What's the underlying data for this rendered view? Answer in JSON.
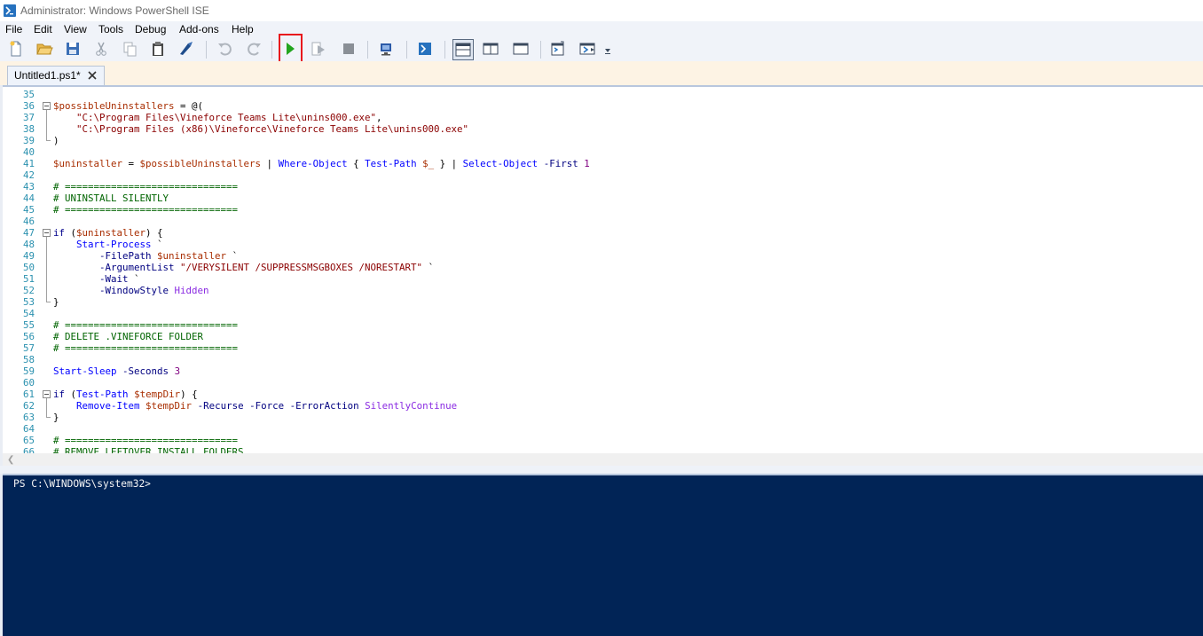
{
  "window": {
    "title": "Administrator: Windows PowerShell ISE",
    "icon": "powershell-ise-icon"
  },
  "menu": [
    "File",
    "Edit",
    "View",
    "Tools",
    "Debug",
    "Add-ons",
    "Help"
  ],
  "toolbar": {
    "buttons": [
      "new-script-icon",
      "open-icon",
      "save-icon",
      "cut-icon",
      "copy-icon",
      "paste-icon",
      "clear-console-icon",
      "undo-icon",
      "redo-icon",
      "run-script-icon",
      "run-selection-icon",
      "stop-icon",
      "new-remote-tab-icon",
      "start-powershell-icon",
      "show-script-pane-top-icon",
      "show-script-pane-right-icon",
      "show-script-pane-maximized-icon",
      "show-command-window-icon",
      "show-command-addon-icon",
      "customize-toolbar-icon"
    ],
    "highlighted": "run-script-icon",
    "highlight_color": "#e8161c",
    "run_color": "#22a51f"
  },
  "tab": {
    "label": "Untitled1.ps1*",
    "close": "×"
  },
  "editor": {
    "lines": [
      {
        "n": "35",
        "segments": []
      },
      {
        "n": "36",
        "segments": [
          {
            "t": "var",
            "v": "$possibleUninstallers"
          },
          {
            "t": "plain",
            "v": " = @("
          }
        ]
      },
      {
        "n": "37",
        "segments": [
          {
            "t": "plain",
            "v": "    "
          },
          {
            "t": "str",
            "v": "\"C:\\Program Files\\Vineforce Teams Lite\\unins000.exe\""
          },
          {
            "t": "plain",
            "v": ","
          }
        ]
      },
      {
        "n": "38",
        "segments": [
          {
            "t": "plain",
            "v": "    "
          },
          {
            "t": "str",
            "v": "\"C:\\Program Files (x86)\\Vineforce\\Vineforce Teams Lite\\unins000.exe\""
          }
        ]
      },
      {
        "n": "39",
        "segments": [
          {
            "t": "plain",
            "v": ")"
          }
        ]
      },
      {
        "n": "40",
        "segments": []
      },
      {
        "n": "41",
        "segments": [
          {
            "t": "var",
            "v": "$uninstaller"
          },
          {
            "t": "plain",
            "v": " = "
          },
          {
            "t": "var",
            "v": "$possibleUninstallers"
          },
          {
            "t": "plain",
            "v": " | "
          },
          {
            "t": "cmd",
            "v": "Where-Object"
          },
          {
            "t": "plain",
            "v": " { "
          },
          {
            "t": "cmd",
            "v": "Test-Path"
          },
          {
            "t": "plain",
            "v": " "
          },
          {
            "t": "var",
            "v": "$_"
          },
          {
            "t": "plain",
            "v": " } | "
          },
          {
            "t": "cmd",
            "v": "Select-Object"
          },
          {
            "t": "plain",
            "v": " "
          },
          {
            "t": "param",
            "v": "-First"
          },
          {
            "t": "plain",
            "v": " "
          },
          {
            "t": "num",
            "v": "1"
          }
        ]
      },
      {
        "n": "42",
        "segments": []
      },
      {
        "n": "43",
        "segments": [
          {
            "t": "com",
            "v": "# =============================="
          }
        ]
      },
      {
        "n": "44",
        "segments": [
          {
            "t": "com",
            "v": "# UNINSTALL SILENTLY"
          }
        ]
      },
      {
        "n": "45",
        "segments": [
          {
            "t": "com",
            "v": "# =============================="
          }
        ]
      },
      {
        "n": "46",
        "segments": []
      },
      {
        "n": "47",
        "segments": [
          {
            "t": "kw",
            "v": "if"
          },
          {
            "t": "plain",
            "v": " ("
          },
          {
            "t": "var",
            "v": "$uninstaller"
          },
          {
            "t": "plain",
            "v": ") {"
          }
        ]
      },
      {
        "n": "48",
        "segments": [
          {
            "t": "plain",
            "v": "    "
          },
          {
            "t": "cmd",
            "v": "Start-Process"
          },
          {
            "t": "plain",
            "v": " `"
          }
        ]
      },
      {
        "n": "49",
        "segments": [
          {
            "t": "plain",
            "v": "        "
          },
          {
            "t": "param",
            "v": "-FilePath"
          },
          {
            "t": "plain",
            "v": " "
          },
          {
            "t": "var",
            "v": "$uninstaller"
          },
          {
            "t": "plain",
            "v": " `"
          }
        ]
      },
      {
        "n": "50",
        "segments": [
          {
            "t": "plain",
            "v": "        "
          },
          {
            "t": "param",
            "v": "-ArgumentList"
          },
          {
            "t": "plain",
            "v": " "
          },
          {
            "t": "str",
            "v": "\"/VERYSILENT /SUPPRESSMSGBOXES /NORESTART\""
          },
          {
            "t": "plain",
            "v": " `"
          }
        ]
      },
      {
        "n": "51",
        "segments": [
          {
            "t": "plain",
            "v": "        "
          },
          {
            "t": "param",
            "v": "-Wait"
          },
          {
            "t": "plain",
            "v": " `"
          }
        ]
      },
      {
        "n": "52",
        "segments": [
          {
            "t": "plain",
            "v": "        "
          },
          {
            "t": "param",
            "v": "-WindowStyle"
          },
          {
            "t": "plain",
            "v": " "
          },
          {
            "t": "arg",
            "v": "Hidden"
          }
        ]
      },
      {
        "n": "53",
        "segments": [
          {
            "t": "plain",
            "v": "}"
          }
        ]
      },
      {
        "n": "54",
        "segments": []
      },
      {
        "n": "55",
        "segments": [
          {
            "t": "com",
            "v": "# =============================="
          }
        ]
      },
      {
        "n": "56",
        "segments": [
          {
            "t": "com",
            "v": "# DELETE .VINEFORCE FOLDER"
          }
        ]
      },
      {
        "n": "57",
        "segments": [
          {
            "t": "com",
            "v": "# =============================="
          }
        ]
      },
      {
        "n": "58",
        "segments": []
      },
      {
        "n": "59",
        "segments": [
          {
            "t": "cmd",
            "v": "Start-Sleep"
          },
          {
            "t": "plain",
            "v": " "
          },
          {
            "t": "param",
            "v": "-Seconds"
          },
          {
            "t": "plain",
            "v": " "
          },
          {
            "t": "num",
            "v": "3"
          }
        ]
      },
      {
        "n": "60",
        "segments": []
      },
      {
        "n": "61",
        "segments": [
          {
            "t": "kw",
            "v": "if"
          },
          {
            "t": "plain",
            "v": " ("
          },
          {
            "t": "cmd",
            "v": "Test-Path"
          },
          {
            "t": "plain",
            "v": " "
          },
          {
            "t": "var",
            "v": "$tempDir"
          },
          {
            "t": "plain",
            "v": ") {"
          }
        ]
      },
      {
        "n": "62",
        "segments": [
          {
            "t": "plain",
            "v": "    "
          },
          {
            "t": "cmd",
            "v": "Remove-Item"
          },
          {
            "t": "plain",
            "v": " "
          },
          {
            "t": "var",
            "v": "$tempDir"
          },
          {
            "t": "plain",
            "v": " "
          },
          {
            "t": "param",
            "v": "-Recurse"
          },
          {
            "t": "plain",
            "v": " "
          },
          {
            "t": "param",
            "v": "-Force"
          },
          {
            "t": "plain",
            "v": " "
          },
          {
            "t": "param",
            "v": "-ErrorAction"
          },
          {
            "t": "plain",
            "v": " "
          },
          {
            "t": "arg",
            "v": "SilentlyContinue"
          }
        ]
      },
      {
        "n": "63",
        "segments": [
          {
            "t": "plain",
            "v": "}"
          }
        ]
      },
      {
        "n": "64",
        "segments": []
      },
      {
        "n": "65",
        "segments": [
          {
            "t": "com",
            "v": "# =============================="
          }
        ]
      },
      {
        "n": "66",
        "segments": [
          {
            "t": "com",
            "v": "# REMOVE LEFTOVER INSTALL FOLDERS"
          }
        ]
      }
    ],
    "fold_markers": [
      "36",
      "47",
      "61"
    ],
    "syntax_colors": {
      "var": "#a82d00",
      "str": "#8b0000",
      "cmd": "#0000ff",
      "param": "#000080",
      "com": "#006400",
      "num": "#800080",
      "kw": "#00008b",
      "arg": "#8a2be2",
      "plain": "#000000"
    }
  },
  "console": {
    "prompt": "PS C:\\WINDOWS\\system32>",
    "background": "#012456"
  }
}
